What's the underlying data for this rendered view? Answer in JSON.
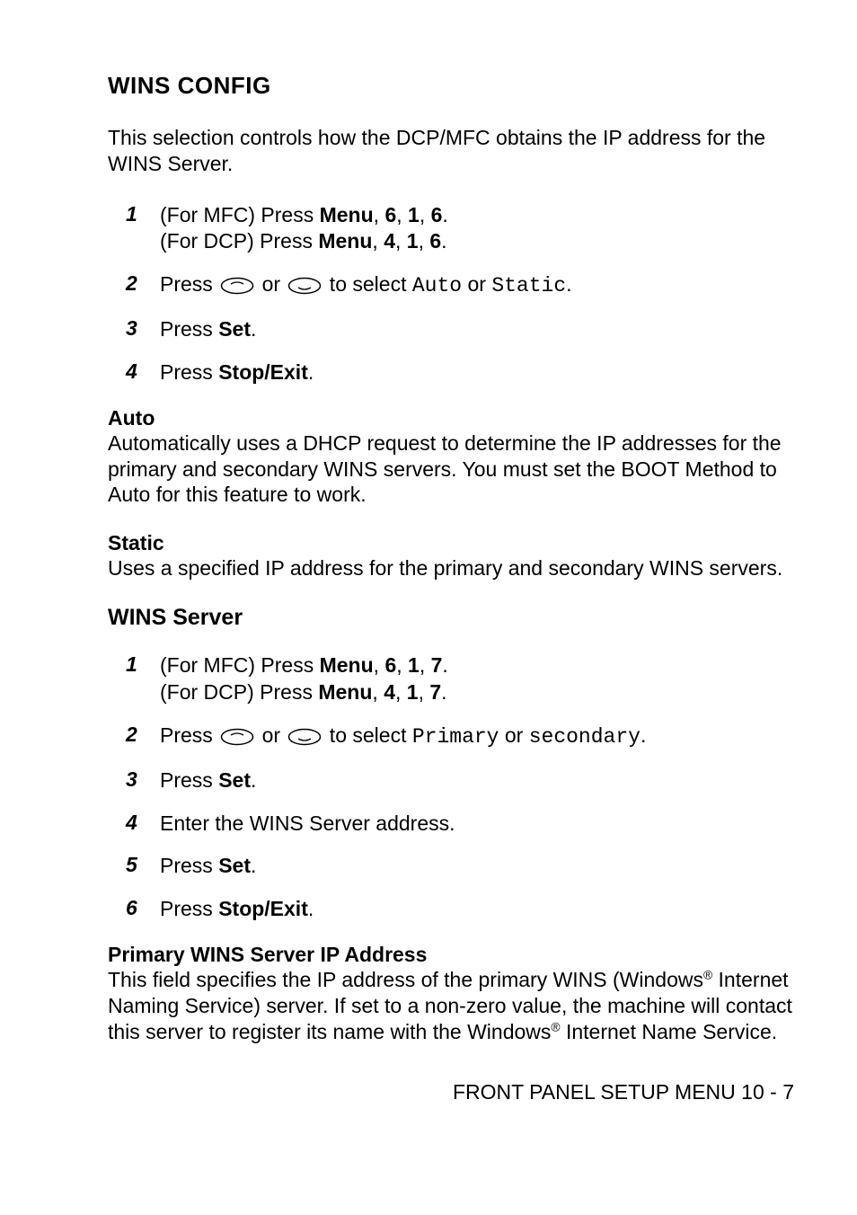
{
  "section1": {
    "title": "WINS CONFIG",
    "intro": "This selection controls how the DCP/MFC obtains the IP address for the WINS Server.",
    "steps": [
      {
        "num": "1",
        "lines_html": "(For MFC) Press <span class='b'>Menu</span>, <span class='b'>6</span>, <span class='b'>1</span>, <span class='b'>6</span>.<br>(For DCP) Press <span class='b'>Menu</span>, <span class='b'>4</span>, <span class='b'>1</span>, <span class='b'>6</span>."
      },
      {
        "num": "2",
        "lines_html": "Press {{oval-up}} or {{oval-down}} to select <span class='mono'>Auto</span> or <span class='mono'>Static</span>."
      },
      {
        "num": "3",
        "lines_html": "Press <span class='b'>Set</span>."
      },
      {
        "num": "4",
        "lines_html": "Press <span class='b'>Stop/Exit</span>."
      }
    ],
    "auto_head": "Auto",
    "auto_body": "Automatically uses a DHCP request to determine the IP addresses for the primary and secondary WINS servers. You must set the BOOT Method to Auto for this feature to work.",
    "static_head": "Static",
    "static_body": "Uses a specified IP address for the primary and secondary WINS servers."
  },
  "section2": {
    "title": "WINS Server",
    "steps": [
      {
        "num": "1",
        "lines_html": "(For MFC) Press <span class='b'>Menu</span>, <span class='b'>6</span>, <span class='b'>1</span>, <span class='b'>7</span>.<br>(For DCP) Press <span class='b'>Menu</span>, <span class='b'>4</span>, <span class='b'>1</span>, <span class='b'>7</span>."
      },
      {
        "num": "2",
        "lines_html": "Press {{oval-up}} or {{oval-down}} to select <span class='mono'>Primary</span> or <span class='mono'>secondary</span>."
      },
      {
        "num": "3",
        "lines_html": "Press <span class='b'>Set</span>."
      },
      {
        "num": "4",
        "lines_html": "Enter the WINS Server address."
      },
      {
        "num": "5",
        "lines_html": "Press <span class='b'>Set</span>."
      },
      {
        "num": "6",
        "lines_html": "Press <span class='b'>Stop/Exit</span>."
      }
    ],
    "primary_head": "Primary WINS Server IP Address",
    "primary_body_html": "This field specifies the IP address of the primary WINS (Windows<sup>®</sup> Internet Naming Service) server. If set to a non-zero value, the machine will contact this server to register its name with the Windows<sup>®</sup> Internet Name Service."
  },
  "footer": "FRONT PANEL SETUP MENU 10 - 7"
}
